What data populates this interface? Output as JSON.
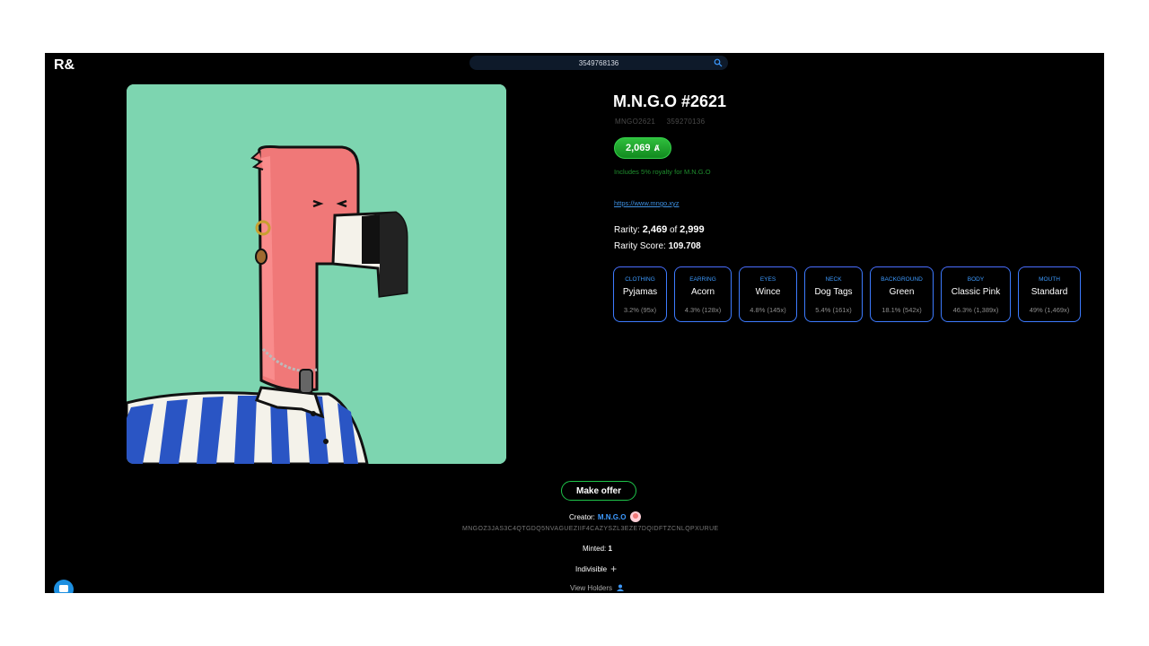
{
  "header": {
    "logo": "R&",
    "search_value": "3549768136"
  },
  "asset": {
    "title": "M.N.G.O #2621",
    "unit_name": "MNGO2621",
    "asset_id": "359270136",
    "price": "2,069",
    "price_currency_icon": "algo-icon",
    "royalty_note": "Includes 5% royalty for M.N.G.O",
    "website": "https://www.mngo.xyz",
    "rarity_label": "Rarity:",
    "rarity_rank": "2,469",
    "rarity_of": "of",
    "rarity_total": "2,999",
    "rarity_score_label": "Rarity Score:",
    "rarity_score": "109.708"
  },
  "traits": [
    {
      "name": "CLOTHING",
      "value": "Pyjamas",
      "pct": "3.2% (95x)"
    },
    {
      "name": "EARRING",
      "value": "Acorn",
      "pct": "4.3% (128x)"
    },
    {
      "name": "EYES",
      "value": "Wince",
      "pct": "4.8% (145x)"
    },
    {
      "name": "NECK",
      "value": "Dog Tags",
      "pct": "5.4% (161x)"
    },
    {
      "name": "BACKGROUND",
      "value": "Green",
      "pct": "18.1% (542x)"
    },
    {
      "name": "BODY",
      "value": "Classic Pink",
      "pct": "46.3% (1,389x)"
    },
    {
      "name": "MOUTH",
      "value": "Standard",
      "pct": "49% (1,469x)"
    }
  ],
  "actions": {
    "make_offer": "Make offer"
  },
  "creator": {
    "label": "Creator:",
    "name": "M.N.G.O",
    "address": "MNGOZ3JAS3C4QTGDQ5NVAGUEZIIF4CAZYSZL3EZE7DQIDFTZCNLQPXURUE"
  },
  "details": {
    "minted_label": "Minted:",
    "minted_value": "1",
    "indivisible": "Indivisible",
    "view_holders": "View Holders"
  },
  "colors": {
    "background": "#000000",
    "accent_blue": "#3d7bff",
    "price_green": "#1fa02e",
    "art_bg": "#7dd5b0"
  }
}
